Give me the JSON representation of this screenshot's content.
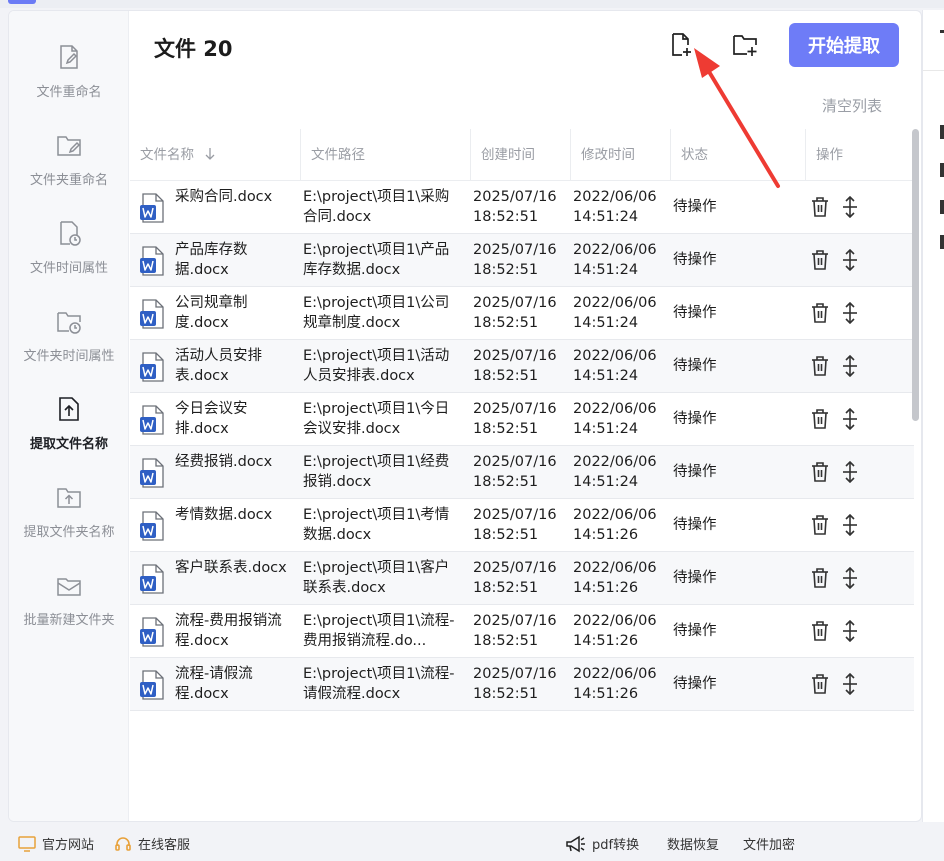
{
  "sidebar": {
    "items": [
      {
        "label": "文件重命名",
        "icon": "file-edit-icon"
      },
      {
        "label": "文件夹重命名",
        "icon": "folder-edit-icon"
      },
      {
        "label": "文件时间属性",
        "icon": "file-clock-icon"
      },
      {
        "label": "文件夹时间属性",
        "icon": "folder-clock-icon"
      },
      {
        "label": "提取文件名称",
        "icon": "file-upload-icon",
        "active": true
      },
      {
        "label": "提取文件夹名称",
        "icon": "folder-upload-icon"
      },
      {
        "label": "批量新建文件夹",
        "icon": "folder-mail-icon"
      }
    ]
  },
  "header": {
    "title": "文件 20",
    "add_file_icon": "file-plus-icon",
    "add_folder_icon": "folder-plus-icon",
    "start_button": "开始提取",
    "clear_list": "清空列表"
  },
  "table": {
    "columns": [
      "文件名称",
      "文件路径",
      "创建时间",
      "修改时间",
      "状态",
      "操作"
    ],
    "sort_icon": "arrow-down-icon",
    "rows": [
      {
        "name": "采购合同.docx",
        "path": "E:\\project\\项目1\\采购合同.docx",
        "created": "2025/07/16 18:52:51",
        "modified": "2022/06/06 14:51:24",
        "status": "待操作"
      },
      {
        "name": "产品库存数据.docx",
        "path": "E:\\project\\项目1\\产品库存数据.docx",
        "created": "2025/07/16 18:52:51",
        "modified": "2022/06/06 14:51:24",
        "status": "待操作"
      },
      {
        "name": "公司规章制度.docx",
        "path": "E:\\project\\项目1\\公司规章制度.docx",
        "created": "2025/07/16 18:52:51",
        "modified": "2022/06/06 14:51:24",
        "status": "待操作"
      },
      {
        "name": "活动人员安排表.docx",
        "path": "E:\\project\\项目1\\活动人员安排表.docx",
        "created": "2025/07/16 18:52:51",
        "modified": "2022/06/06 14:51:24",
        "status": "待操作"
      },
      {
        "name": "今日会议安排.docx",
        "path": "E:\\project\\项目1\\今日会议安排.docx",
        "created": "2025/07/16 18:52:51",
        "modified": "2022/06/06 14:51:24",
        "status": "待操作"
      },
      {
        "name": "经费报销.docx",
        "path": "E:\\project\\项目1\\经费报销.docx",
        "created": "2025/07/16 18:52:51",
        "modified": "2022/06/06 14:51:24",
        "status": "待操作"
      },
      {
        "name": "考情数据.docx",
        "path": "E:\\project\\项目1\\考情数据.docx",
        "created": "2025/07/16 18:52:51",
        "modified": "2022/06/06 14:51:26",
        "status": "待操作"
      },
      {
        "name": "客户联系表.docx",
        "path": "E:\\project\\项目1\\客户联系表.docx",
        "created": "2025/07/16 18:52:51",
        "modified": "2022/06/06 14:51:26",
        "status": "待操作"
      },
      {
        "name": "流程-费用报销流程.docx",
        "path": "E:\\project\\项目1\\流程-费用报销流程.do...",
        "created": "2025/07/16 18:52:51",
        "modified": "2022/06/06 14:51:26",
        "status": "待操作"
      },
      {
        "name": "流程-请假流程.docx",
        "path": "E:\\project\\项目1\\流程-请假流程.docx",
        "created": "2025/07/16 18:52:51",
        "modified": "2022/06/06 14:51:26",
        "status": "待操作"
      }
    ]
  },
  "footer": {
    "website": "官方网站",
    "support": "在线客服",
    "pdf": "pdf转换",
    "recovery": "数据恢复",
    "encrypt": "文件加密"
  },
  "colors": {
    "accent": "#6e7cf7",
    "annotation_arrow": "#ee3b33",
    "word_blue": "#2f5fc4"
  }
}
